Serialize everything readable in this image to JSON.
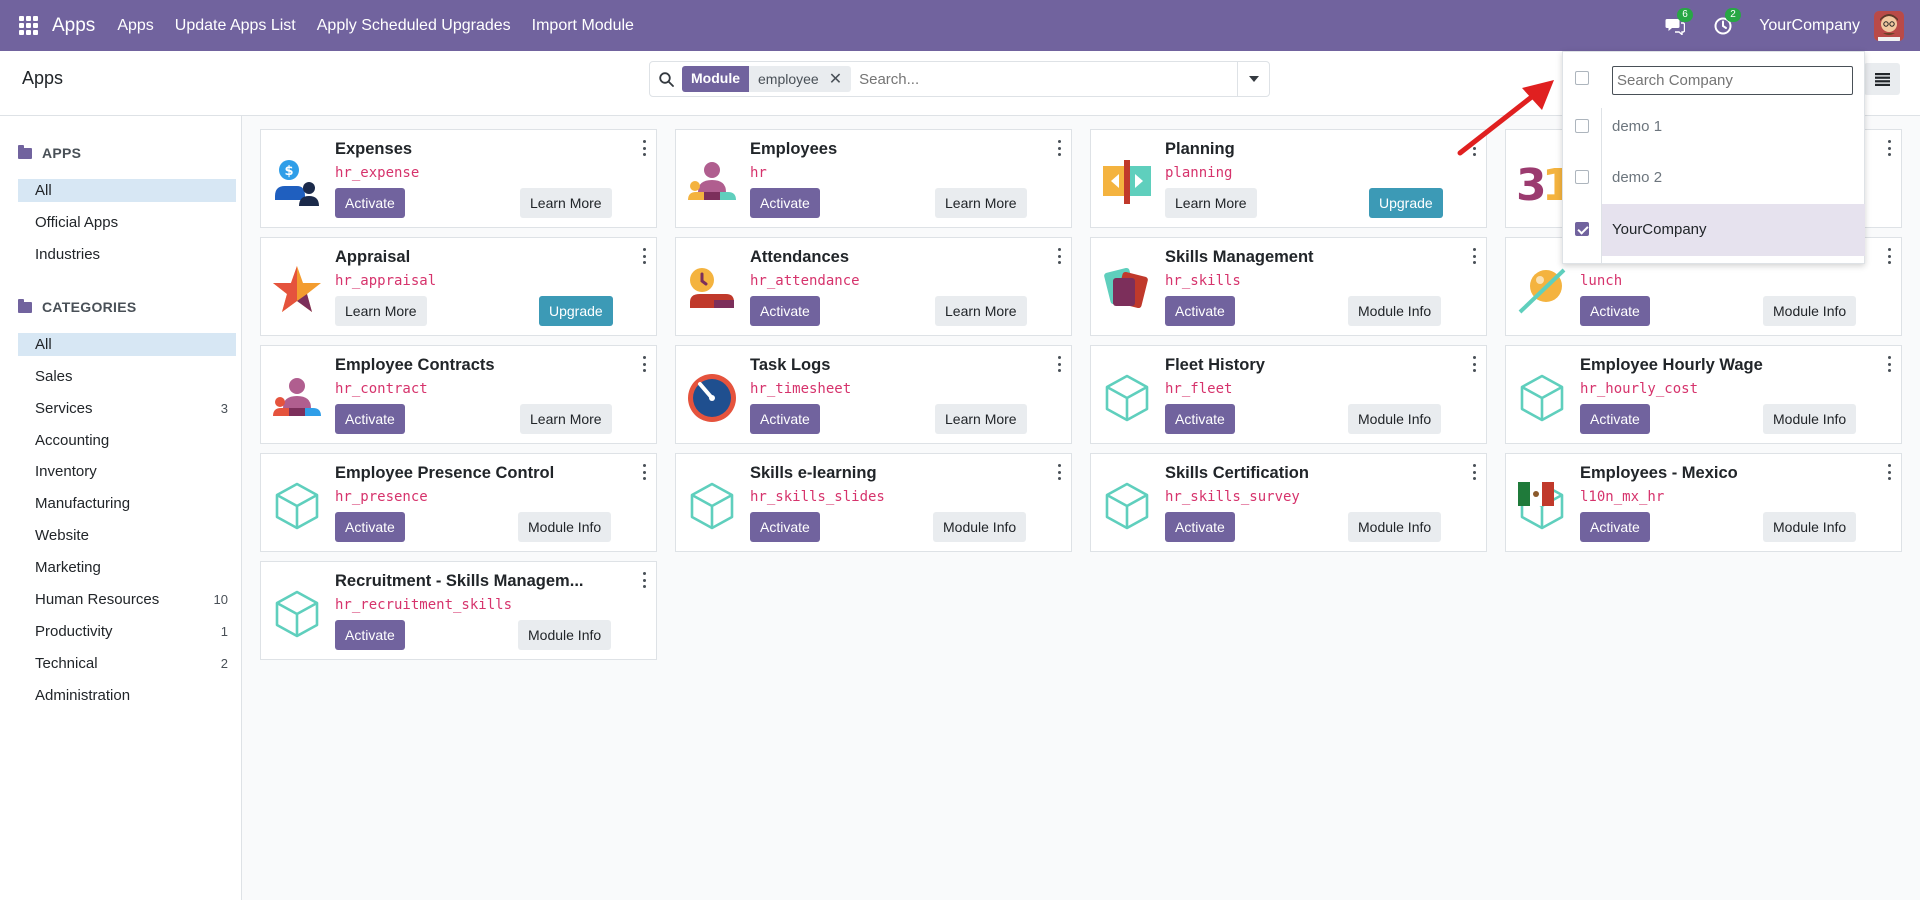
{
  "navbar": {
    "brand": "Apps",
    "menu": [
      "Apps",
      "Update Apps List",
      "Apply Scheduled Upgrades",
      "Import Module"
    ],
    "messages_count": "6",
    "activities_count": "2",
    "company": "YourCompany",
    "badge_color": "#28a745",
    "accent_color": "#71639e"
  },
  "control": {
    "breadcrumb": "Apps",
    "facet_label": "Module",
    "facet_value": "employee",
    "search_placeholder": "Search..."
  },
  "sidebar": {
    "apps_header": "APPS",
    "apps_items": [
      {
        "label": "All",
        "active": true
      },
      {
        "label": "Official Apps"
      },
      {
        "label": "Industries"
      }
    ],
    "categories_header": "CATEGORIES",
    "categories": [
      {
        "label": "All",
        "count": "",
        "active": true
      },
      {
        "label": "Sales",
        "count": ""
      },
      {
        "label": "Services",
        "count": "3"
      },
      {
        "label": "Accounting",
        "count": ""
      },
      {
        "label": "Inventory",
        "count": ""
      },
      {
        "label": "Manufacturing",
        "count": ""
      },
      {
        "label": "Website",
        "count": ""
      },
      {
        "label": "Marketing",
        "count": ""
      },
      {
        "label": "Human Resources",
        "count": "10"
      },
      {
        "label": "Productivity",
        "count": "1"
      },
      {
        "label": "Technical",
        "count": "2"
      },
      {
        "label": "Administration",
        "count": ""
      }
    ]
  },
  "cards": [
    {
      "title": "Expenses",
      "tech": "hr_expense",
      "icon": "expenses-icon",
      "left_btn": "Activate",
      "right_btn": "Learn More"
    },
    {
      "title": "Employees",
      "tech": "hr",
      "icon": "employees-icon",
      "left_btn": "Activate",
      "right_btn": "Learn More"
    },
    {
      "title": "Planning",
      "tech": "planning",
      "icon": "planning-icon",
      "left_btn": "Learn More",
      "right_btn": "Upgrade"
    },
    {
      "title": "",
      "tech": "",
      "icon": "calendar-icon",
      "left_btn": "",
      "right_btn": ""
    },
    {
      "title": "Appraisal",
      "tech": "hr_appraisal",
      "icon": "appraisal-icon",
      "left_btn": "Learn More",
      "right_btn": "Upgrade"
    },
    {
      "title": "Attendances",
      "tech": "hr_attendance",
      "icon": "attendances-icon",
      "left_btn": "Activate",
      "right_btn": "Learn More"
    },
    {
      "title": "Skills Management",
      "tech": "hr_skills",
      "icon": "skills-icon",
      "left_btn": "Activate",
      "right_btn": "Module Info"
    },
    {
      "title": "",
      "tech": "lunch",
      "icon": "lunch-icon",
      "left_btn": "Activate",
      "right_btn": "Module Info"
    },
    {
      "title": "Employee Contracts",
      "tech": "hr_contract",
      "icon": "contracts-icon",
      "left_btn": "Activate",
      "right_btn": "Learn More"
    },
    {
      "title": "Task Logs",
      "tech": "hr_timesheet",
      "icon": "timesheet-icon",
      "left_btn": "Activate",
      "right_btn": "Learn More"
    },
    {
      "title": "Fleet History",
      "tech": "hr_fleet",
      "icon": "module-cube-icon",
      "left_btn": "Activate",
      "right_btn": "Module Info"
    },
    {
      "title": "Employee Hourly Wage",
      "tech": "hr_hourly_cost",
      "icon": "module-cube-icon",
      "left_btn": "Activate",
      "right_btn": "Module Info"
    },
    {
      "title": "Employee Presence Control",
      "tech": "hr_presence",
      "icon": "module-cube-icon",
      "left_btn": "Activate",
      "right_btn": "Module Info"
    },
    {
      "title": "Skills e-learning",
      "tech": "hr_skills_slides",
      "icon": "module-cube-icon",
      "left_btn": "Activate",
      "right_btn": "Module Info"
    },
    {
      "title": "Skills Certification",
      "tech": "hr_skills_survey",
      "icon": "module-cube-icon",
      "left_btn": "Activate",
      "right_btn": "Module Info"
    },
    {
      "title": "Employees - Mexico",
      "tech": "l10n_mx_hr",
      "icon": "mexico-flag-icon",
      "left_btn": "Activate",
      "right_btn": "Module Info"
    },
    {
      "title": "Recruitment - Skills Managem...",
      "tech": "hr_recruitment_skills",
      "icon": "module-cube-icon",
      "left_btn": "Activate",
      "right_btn": "Module Info"
    }
  ],
  "company_dropdown": {
    "search_placeholder": "Search Company",
    "companies": [
      {
        "label": "demo 1",
        "checked": false
      },
      {
        "label": "demo 2",
        "checked": false
      },
      {
        "label": "YourCompany",
        "checked": true
      }
    ]
  }
}
